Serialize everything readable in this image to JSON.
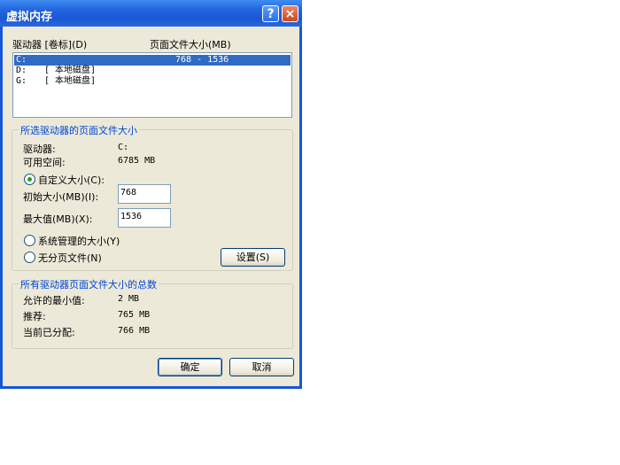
{
  "window": {
    "title": "虚拟内存",
    "help_glyph": "?",
    "close_glyph": "×"
  },
  "list": {
    "header_drive": "驱动器 [卷标](D)",
    "header_size": "页面文件大小(MB)",
    "rows": [
      {
        "drive": "C:",
        "label": "",
        "size": "768 - 1536",
        "selected": true
      },
      {
        "drive": "D:",
        "label": "[ 本地磁盘]",
        "size": "",
        "selected": false
      },
      {
        "drive": "G:",
        "label": "[ 本地磁盘]",
        "size": "",
        "selected": false
      }
    ]
  },
  "selected_group": {
    "title": "所选驱动器的页面文件大小",
    "drive_label": "驱动器:",
    "drive_value": "C:",
    "space_label": "可用空间:",
    "space_value": "6785 MB",
    "custom_label": "自定义大小(C):",
    "initial_label": "初始大小(MB)(I):",
    "initial_value": "768",
    "max_label": "最大值(MB)(X):",
    "max_value": "1536",
    "system_label": "系统管理的大小(Y)",
    "nopaging_label": "无分页文件(N)",
    "set_button": "设置(S)",
    "selected_option": "custom"
  },
  "total_group": {
    "title": "所有驱动器页面文件大小的总数",
    "min_label": "允许的最小值:",
    "min_value": "2 MB",
    "rec_label": "推荐:",
    "rec_value": "765 MB",
    "cur_label": "当前已分配:",
    "cur_value": "766 MB"
  },
  "buttons": {
    "ok": "确定",
    "cancel": "取消"
  }
}
